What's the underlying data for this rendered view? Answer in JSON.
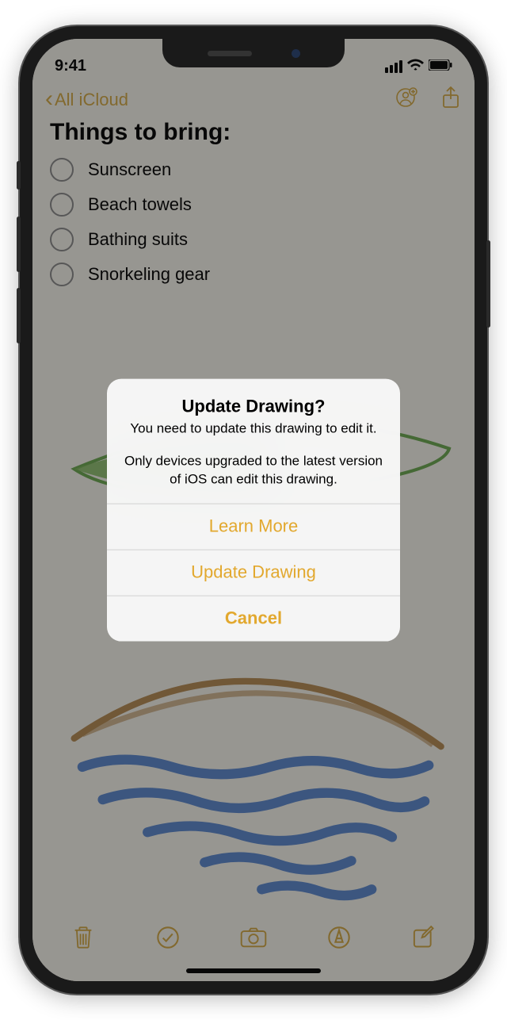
{
  "status": {
    "time": "9:41"
  },
  "nav": {
    "back_label": "All iCloud"
  },
  "note": {
    "title": "Things to bring:",
    "items": [
      "Sunscreen",
      "Beach towels",
      "Bathing suits",
      "Snorkeling gear"
    ]
  },
  "alert": {
    "title": "Update Drawing?",
    "message1": "You need to update this drawing to edit it.",
    "message2": "Only devices upgraded to the latest version of iOS can edit this drawing.",
    "learn_more": "Learn More",
    "update": "Update Drawing",
    "cancel": "Cancel"
  },
  "colors": {
    "accent": "#e2a82e"
  }
}
